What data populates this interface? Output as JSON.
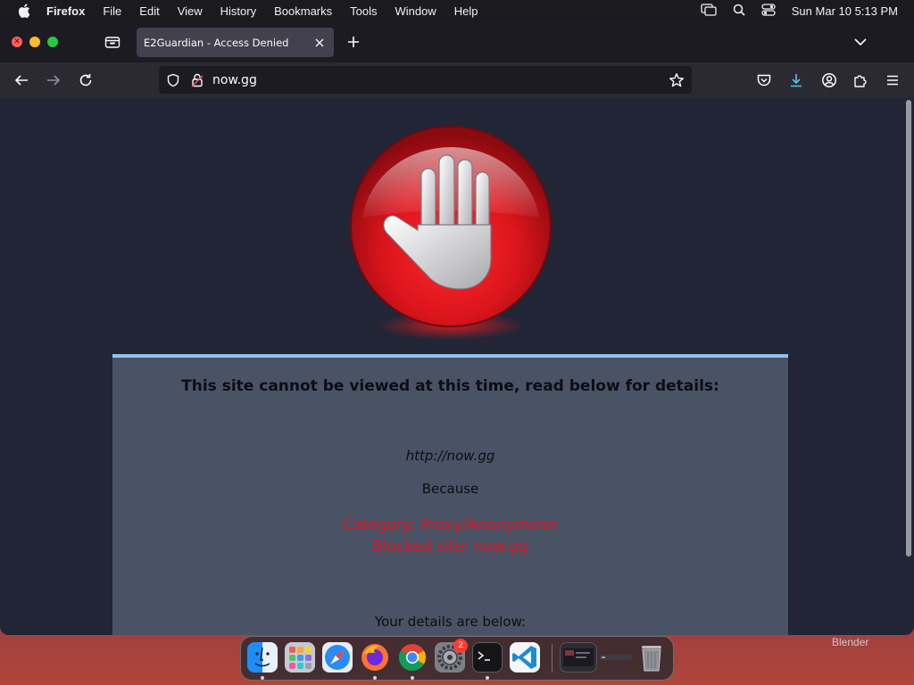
{
  "menubar": {
    "app_name": "Firefox",
    "items": [
      "File",
      "Edit",
      "View",
      "History",
      "Bookmarks",
      "Tools",
      "Window",
      "Help"
    ],
    "clock": "Sun Mar 10  5:13 PM",
    "status_icons": [
      "screen-mirroring-icon",
      "spotlight-search-icon",
      "control-center-icon"
    ]
  },
  "browser": {
    "tab": {
      "title": "E2Guardian - Access Denied"
    },
    "url": "now.gg",
    "toolbar_icons": [
      "pocket-icon",
      "downloads-icon",
      "account-icon",
      "extensions-icon",
      "menu-icon"
    ],
    "download_accent": "#54c7e8"
  },
  "page": {
    "heading": "This site cannot be viewed at this time, read below for details:",
    "blocked_url": "http://now.gg",
    "because": "Because",
    "category": "Category: Proxy/Anonymizer",
    "blocked_site": "Blocked site: now.gg",
    "details_heading": "Your details are below:",
    "colors": {
      "background": "#222536",
      "panel": "#4a5265",
      "panel_border": "#8fc3ee",
      "reason": "#e0131f"
    }
  },
  "dock": {
    "apps": [
      "finder-icon",
      "launchpad-icon",
      "safari-icon",
      "firefox-icon",
      "chrome-icon",
      "system-settings-icon",
      "terminal-icon",
      "vscode-icon",
      "window-thumbnail",
      "trash-icon"
    ],
    "settings_badge": "2"
  },
  "desktop": {
    "label": "Blender"
  }
}
